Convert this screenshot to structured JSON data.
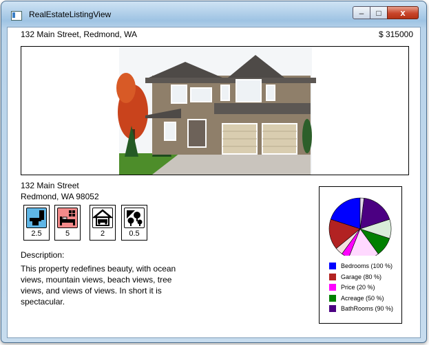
{
  "window": {
    "title": "RealEstateListingView",
    "controls": {
      "minimize": "–",
      "maximize": "□",
      "close": "x"
    }
  },
  "listing": {
    "address_top": "132 Main Street, Redmond, WA",
    "price_top": "$ 315000",
    "street": "132 Main Street",
    "city_line": "Redmond, WA 98052",
    "features": [
      {
        "icon": "bathroom-icon",
        "value": "2.5"
      },
      {
        "icon": "bedroom-icon",
        "value": "5"
      },
      {
        "icon": "garage-icon",
        "value": "2"
      },
      {
        "icon": "acreage-icon",
        "value": "0.5"
      }
    ],
    "description_label": "Description:",
    "description": "This property redefines beauty, with ocean views, mountain views, beach views, tree views, and views of views.  In short it is spectacular."
  },
  "chart_data": {
    "type": "pie",
    "categories": [
      "Bedrooms (100 %)",
      "Garage (80 %)",
      "Price (20 %)",
      "Acreage (50 %)",
      "BathRooms (90 %)"
    ],
    "values": [
      100,
      80,
      20,
      50,
      90
    ],
    "colors": [
      "#0000ff",
      "#b22222",
      "#ff00ff",
      "#008000",
      "#4b0082"
    ]
  },
  "colors": {
    "bathroom_icon_bg": "#5fb6e6",
    "bedroom_icon_bg": "#f28a8a"
  }
}
